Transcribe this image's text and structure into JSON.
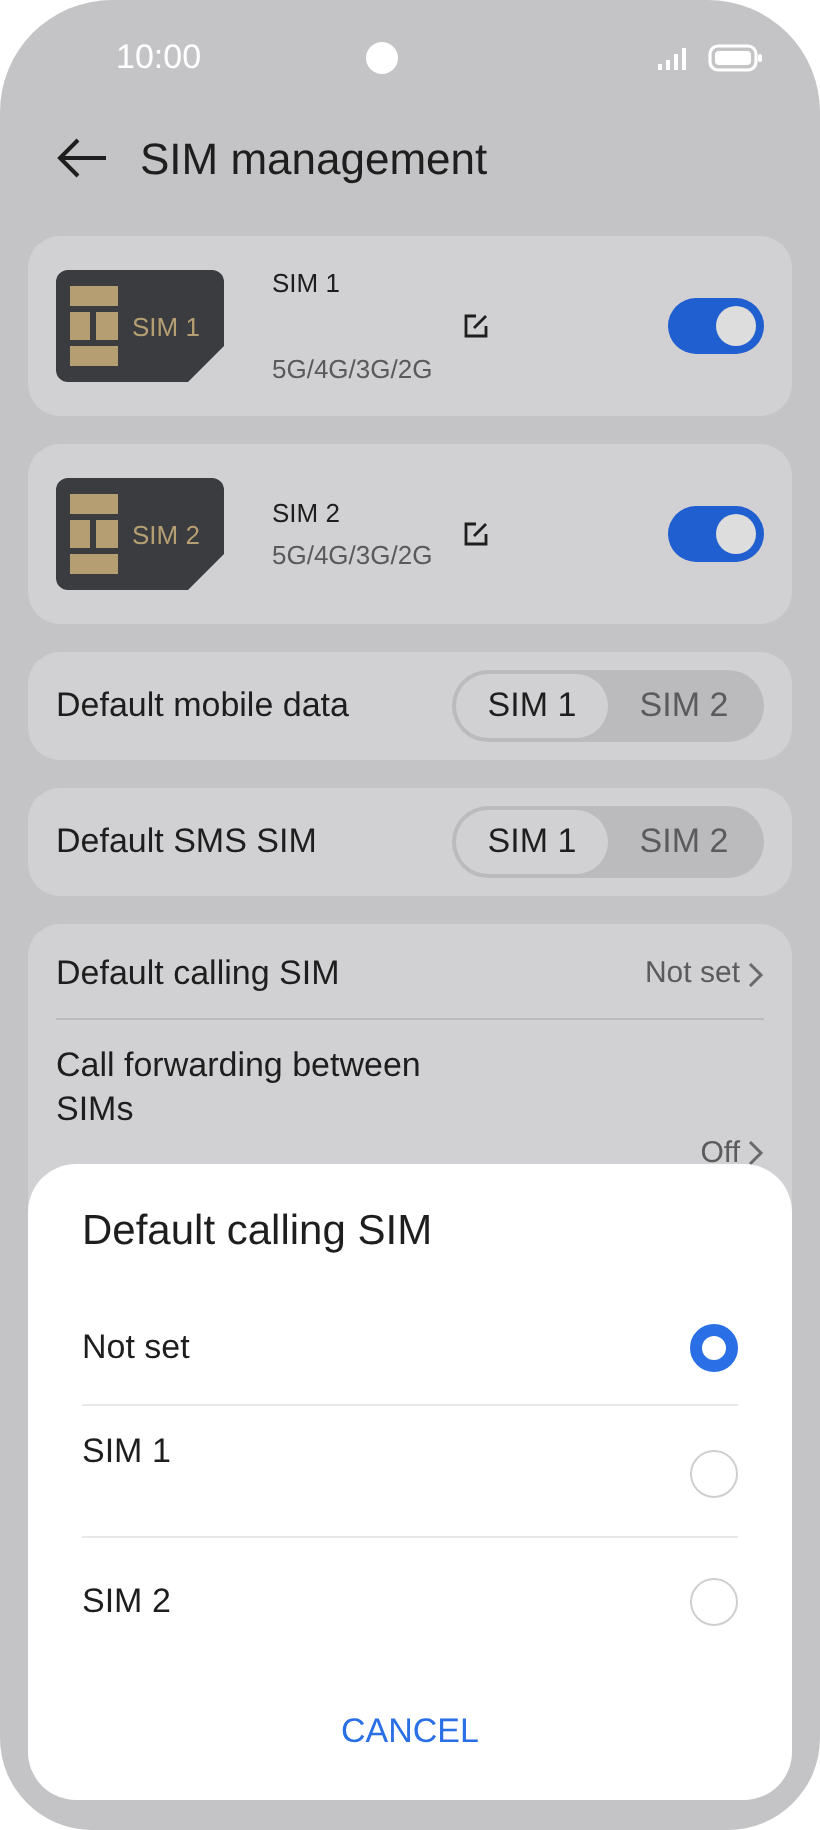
{
  "status_bar": {
    "time": "10:00"
  },
  "header": {
    "title": "SIM management"
  },
  "sims": [
    {
      "name": "SIM 1",
      "chip_label": "SIM 1",
      "networks": "5G/4G/3G/2G",
      "on": true
    },
    {
      "name": "SIM 2",
      "chip_label": "SIM 2",
      "networks": "5G/4G/3G/2G",
      "on": true
    }
  ],
  "selectors": [
    {
      "label": "Default mobile data",
      "options": [
        {
          "label": "SIM 1",
          "selected": true
        },
        {
          "label": "SIM 2",
          "selected": false
        }
      ]
    },
    {
      "label": "Default SMS SIM",
      "options": [
        {
          "label": "SIM 1",
          "selected": true
        },
        {
          "label": "SIM 2",
          "selected": false
        }
      ]
    }
  ],
  "call_settings": [
    {
      "label": "Default calling SIM",
      "value": "Not set"
    },
    {
      "label": "Call forwarding between SIMs",
      "value": "Off"
    }
  ],
  "dialog": {
    "title": "Default calling SIM",
    "options": [
      {
        "label": "Not set",
        "selected": true
      },
      {
        "label": "SIM 1",
        "selected": false
      },
      {
        "label": "SIM 2",
        "selected": false
      }
    ],
    "button": "CANCEL"
  }
}
